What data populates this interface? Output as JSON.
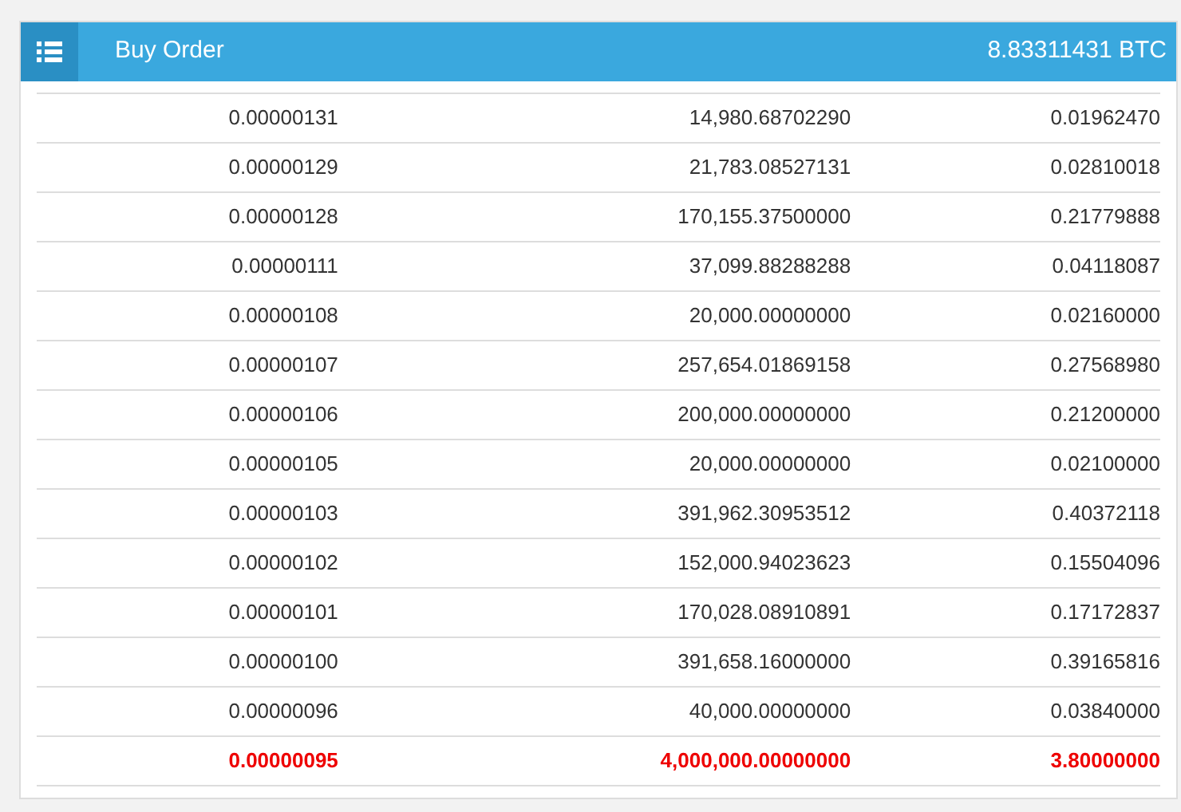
{
  "panel": {
    "title": "Buy Order",
    "total": "8.83311431 BTC"
  },
  "rows": [
    {
      "price": "0.00000131",
      "amount": "14,980.68702290",
      "total": "0.01962470",
      "highlighted": false
    },
    {
      "price": "0.00000129",
      "amount": "21,783.08527131",
      "total": "0.02810018",
      "highlighted": false
    },
    {
      "price": "0.00000128",
      "amount": "170,155.37500000",
      "total": "0.21779888",
      "highlighted": false
    },
    {
      "price": "0.00000111",
      "amount": "37,099.88288288",
      "total": "0.04118087",
      "highlighted": false
    },
    {
      "price": "0.00000108",
      "amount": "20,000.00000000",
      "total": "0.02160000",
      "highlighted": false
    },
    {
      "price": "0.00000107",
      "amount": "257,654.01869158",
      "total": "0.27568980",
      "highlighted": false
    },
    {
      "price": "0.00000106",
      "amount": "200,000.00000000",
      "total": "0.21200000",
      "highlighted": false
    },
    {
      "price": "0.00000105",
      "amount": "20,000.00000000",
      "total": "0.02100000",
      "highlighted": false
    },
    {
      "price": "0.00000103",
      "amount": "391,962.30953512",
      "total": "0.40372118",
      "highlighted": false
    },
    {
      "price": "0.00000102",
      "amount": "152,000.94023623",
      "total": "0.15504096",
      "highlighted": false
    },
    {
      "price": "0.00000101",
      "amount": "170,028.08910891",
      "total": "0.17172837",
      "highlighted": false
    },
    {
      "price": "0.00000100",
      "amount": "391,658.16000000",
      "total": "0.39165816",
      "highlighted": false
    },
    {
      "price": "0.00000096",
      "amount": "40,000.00000000",
      "total": "0.03840000",
      "highlighted": false
    },
    {
      "price": "0.00000095",
      "amount": "4,000,000.00000000",
      "total": "3.80000000",
      "highlighted": true
    }
  ]
}
